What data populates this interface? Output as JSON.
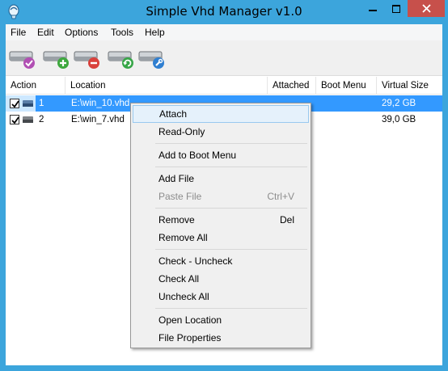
{
  "window": {
    "title": "Simple Vhd Manager v1.0",
    "controls": {
      "minimize": "–",
      "maximize": "□",
      "close": "✕"
    }
  },
  "menubar": [
    "File",
    "Edit",
    "Options",
    "Tools",
    "Help"
  ],
  "toolbar": {
    "buttons": [
      {
        "name": "check-disk",
        "icon": "disk-check-icon",
        "badge_color": "#b14fb3"
      },
      {
        "name": "add-disk",
        "icon": "disk-add-icon",
        "badge_color": "#3ea83e"
      },
      {
        "name": "remove-disk",
        "icon": "disk-remove-icon",
        "badge_color": "#d9413c"
      },
      {
        "name": "refresh-disk",
        "icon": "disk-refresh-icon",
        "badge_color": "#37a648"
      },
      {
        "name": "settings-disk",
        "icon": "disk-settings-icon",
        "badge_color": "#2f7fd1"
      }
    ]
  },
  "list": {
    "columns": [
      "Action",
      "Location",
      "Attached",
      "Boot Menu",
      "Virtual Size"
    ],
    "rows": [
      {
        "checked": true,
        "index": "1",
        "location": "E:\\win_10.vhd",
        "attached": "",
        "boot_menu": "",
        "virtual_size": "29,2 GB",
        "selected": true
      },
      {
        "checked": true,
        "index": "2",
        "location": "E:\\win_7.vhd",
        "attached": "",
        "boot_menu": "",
        "virtual_size": "39,0 GB",
        "selected": false
      }
    ]
  },
  "context_menu": {
    "items": [
      {
        "label": "Attach",
        "shortcut": "",
        "state": "hover"
      },
      {
        "label": "Read-Only",
        "shortcut": "",
        "state": "normal"
      },
      {
        "separator": true
      },
      {
        "label": "Add to Boot Menu",
        "shortcut": "",
        "state": "normal"
      },
      {
        "separator": true
      },
      {
        "label": "Add File",
        "shortcut": "",
        "state": "normal"
      },
      {
        "label": "Paste File",
        "shortcut": "Ctrl+V",
        "state": "disabled"
      },
      {
        "separator": true
      },
      {
        "label": "Remove",
        "shortcut": "Del",
        "state": "normal"
      },
      {
        "label": "Remove All",
        "shortcut": "",
        "state": "normal"
      },
      {
        "separator": true
      },
      {
        "label": "Check - Uncheck",
        "shortcut": "",
        "state": "normal"
      },
      {
        "label": "Check All",
        "shortcut": "",
        "state": "normal"
      },
      {
        "label": "Uncheck All",
        "shortcut": "",
        "state": "normal"
      },
      {
        "separator": true
      },
      {
        "label": "Open Location",
        "shortcut": "",
        "state": "normal"
      },
      {
        "label": "File Properties",
        "shortcut": "",
        "state": "normal"
      }
    ]
  },
  "colors": {
    "titlebar": "#3ca5dc",
    "close_button": "#c7504b",
    "selection": "#3399ff",
    "menu_hover": "#e5f1fb"
  }
}
